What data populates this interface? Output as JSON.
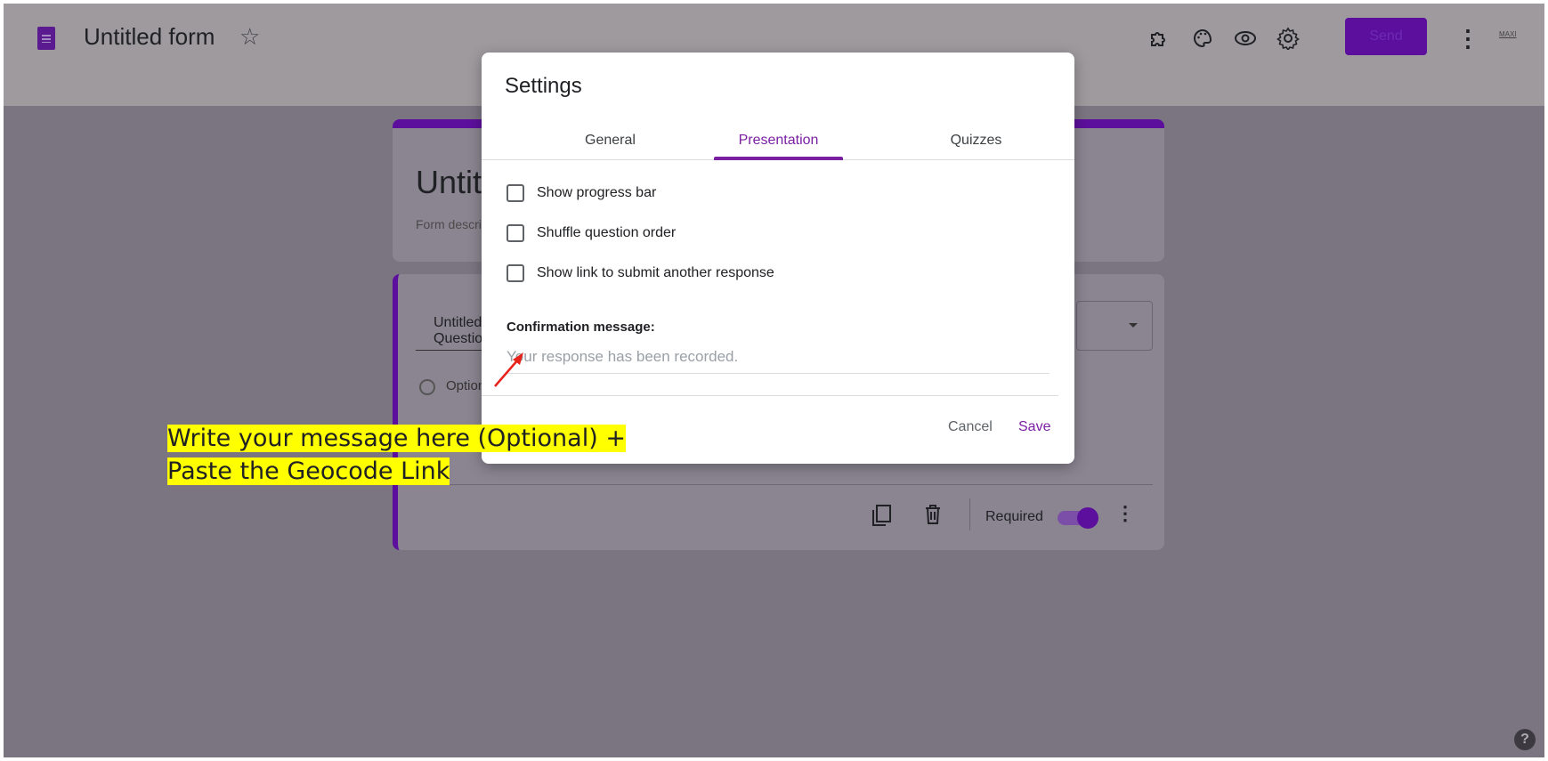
{
  "header": {
    "app_title": "Untitled form",
    "send_label": "Send",
    "account_label": "MAXI"
  },
  "form": {
    "title": "Untitled form",
    "description_placeholder": "Form description",
    "question_title": "Untitled Question",
    "option_label": "Option 1",
    "required_label": "Required",
    "required_on": true
  },
  "dialog": {
    "title": "Settings",
    "tabs": [
      {
        "label": "General",
        "active": false
      },
      {
        "label": "Presentation",
        "active": true
      },
      {
        "label": "Quizzes",
        "active": false
      }
    ],
    "checkboxes": [
      {
        "label": "Show progress bar",
        "checked": false
      },
      {
        "label": "Shuffle question order",
        "checked": false
      },
      {
        "label": "Show link to submit another response",
        "checked": false
      }
    ],
    "confirmation_label": "Confirmation message:",
    "confirmation_placeholder": "Your response has been recorded.",
    "cancel_label": "Cancel",
    "save_label": "Save"
  },
  "annotation": {
    "line1": "Write your message here (Optional) +",
    "line2": "Paste the Geocode Link"
  },
  "colors": {
    "accent": "#7b1fa2",
    "highlight": "#ffff00",
    "arrow": "#e8231c"
  },
  "icons": [
    "forms-doc-icon",
    "star-icon",
    "addon-icon",
    "palette-icon",
    "preview-eye-icon",
    "settings-gear-icon",
    "more-vert-icon",
    "duplicate-icon",
    "delete-icon",
    "help-icon"
  ]
}
